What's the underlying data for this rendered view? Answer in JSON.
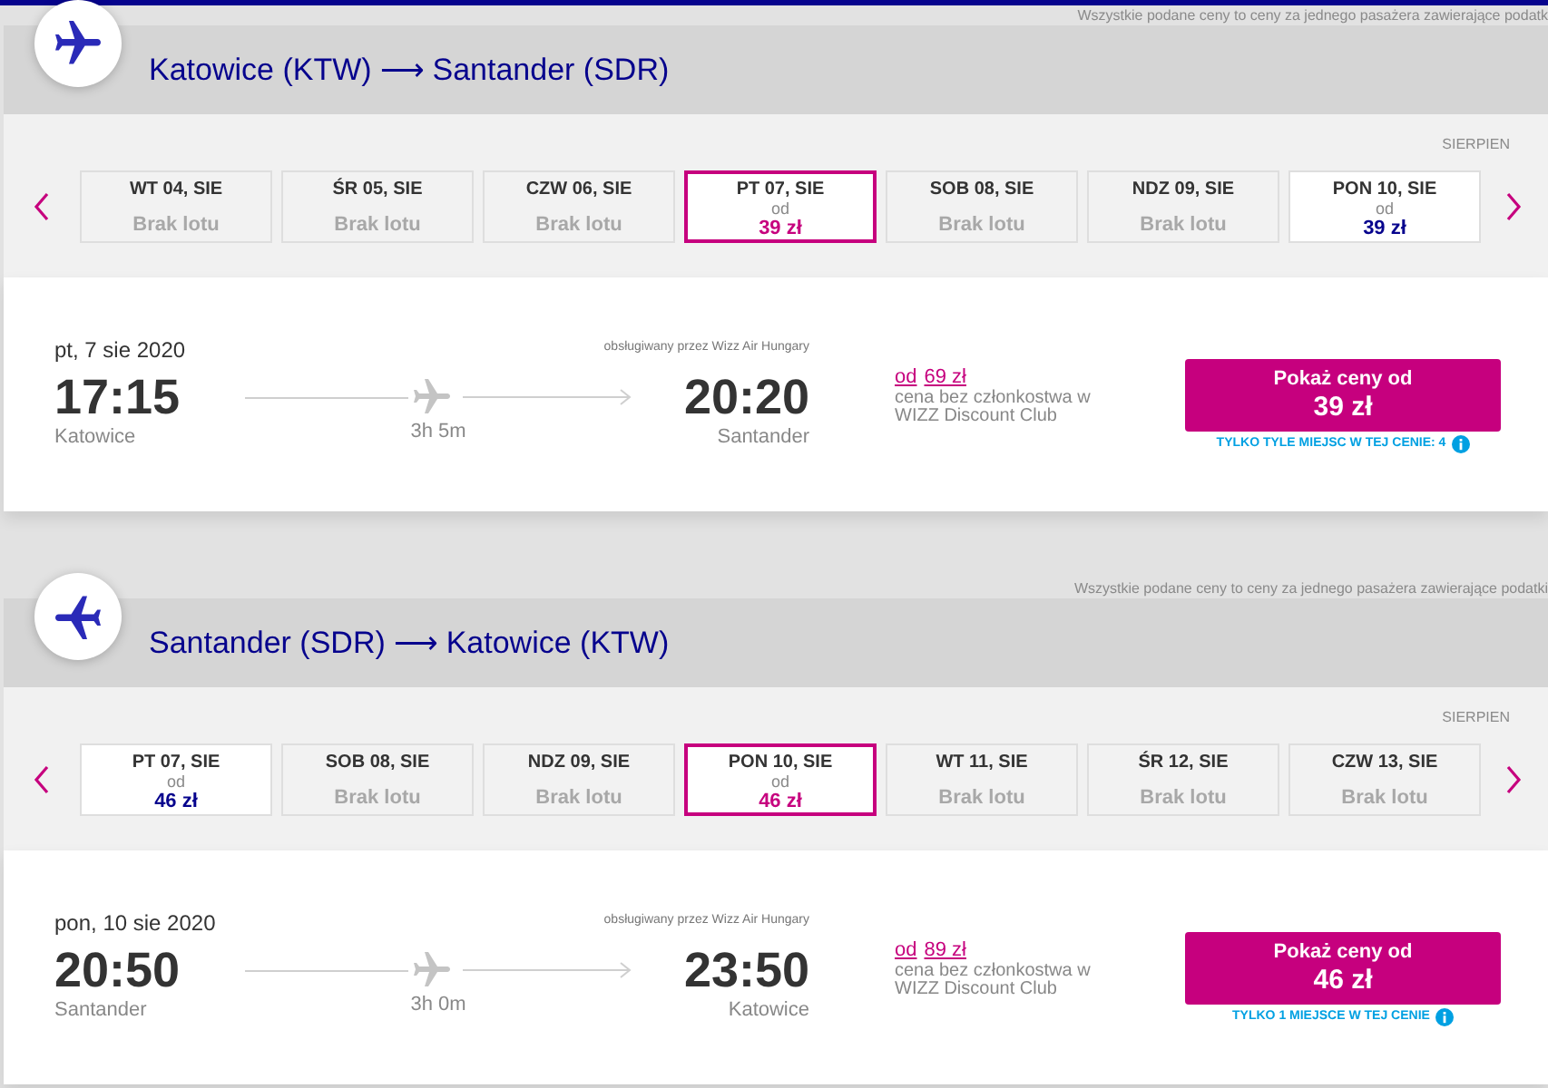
{
  "journeys": [
    {
      "kind": "outbound",
      "notice": "Wszystkie podane ceny to ceny za jednego pasażera zawierające podatk",
      "title": "Katowice (KTW) ⟶ Santander (SDR)",
      "month": "SIERPIEN",
      "dates": [
        {
          "kind": "no-flight",
          "day": "WT 04, SIE",
          "status": "Brak lotu",
          "selected": false
        },
        {
          "kind": "no-flight",
          "day": "ŚR 05, SIE",
          "status": "Brak lotu",
          "selected": false
        },
        {
          "kind": "no-flight",
          "day": "CZW 06, SIE",
          "status": "Brak lotu",
          "selected": false
        },
        {
          "kind": "fare",
          "day": "PT 07, SIE",
          "from": "od",
          "price": "39 zł",
          "selected": true
        },
        {
          "kind": "no-flight",
          "day": "SOB 08, SIE",
          "status": "Brak lotu",
          "selected": false
        },
        {
          "kind": "no-flight",
          "day": "NDZ 09, SIE",
          "status": "Brak lotu",
          "selected": false
        },
        {
          "kind": "fare",
          "day": "PON 10, SIE",
          "from": "od",
          "price": "39 zł",
          "selected": false
        }
      ],
      "flight": {
        "date": "pt, 7 sie 2020",
        "operator": "obsługiwany przez Wizz Air Hungary",
        "departure_time": "17:15",
        "arrival_time": "20:20",
        "departure_city": "Katowice",
        "duration": "3h 5m",
        "arrival_city": "Santander",
        "regular_price_prefix": "od",
        "regular_price": "69 zł",
        "regular_price_note": "cena bez członkostwa w WIZZ Discount Club",
        "button": {
          "label": "Pokaż ceny od",
          "price": "39 zł"
        },
        "seats_note": "TYLKO TYLE MIEJSC W TEJ CENIE: 4"
      }
    },
    {
      "kind": "return",
      "notice": "Wszystkie podane ceny to ceny za jednego pasażera zawierające podatki",
      "title": "Santander (SDR) ⟶ Katowice (KTW)",
      "month": "SIERPIEN",
      "dates": [
        {
          "kind": "fare",
          "day": "PT 07, SIE",
          "from": "od",
          "price": "46 zł",
          "selected": false
        },
        {
          "kind": "no-flight",
          "day": "SOB 08, SIE",
          "status": "Brak lotu",
          "selected": false
        },
        {
          "kind": "no-flight",
          "day": "NDZ 09, SIE",
          "status": "Brak lotu",
          "selected": false
        },
        {
          "kind": "fare",
          "day": "PON 10, SIE",
          "from": "od",
          "price": "46 zł",
          "selected": true
        },
        {
          "kind": "no-flight",
          "day": "WT 11, SIE",
          "status": "Brak lotu",
          "selected": false
        },
        {
          "kind": "no-flight",
          "day": "ŚR 12, SIE",
          "status": "Brak lotu",
          "selected": false
        },
        {
          "kind": "no-flight",
          "day": "CZW 13, SIE",
          "status": "Brak lotu",
          "selected": false
        }
      ],
      "flight": {
        "date": "pon, 10 sie 2020",
        "operator": "obsługiwany przez Wizz Air Hungary",
        "departure_time": "20:50",
        "arrival_time": "23:50",
        "departure_city": "Santander",
        "duration": "3h 0m",
        "arrival_city": "Katowice",
        "regular_price_prefix": "od",
        "regular_price": "89 zł",
        "regular_price_note": "cena bez członkostwa w WIZZ Discount Club",
        "button": {
          "label": "Pokaż ceny od",
          "price": "46 zł"
        },
        "seats_note": "TYLKO 1 MIEJSCE W TEJ CENIE"
      }
    }
  ]
}
